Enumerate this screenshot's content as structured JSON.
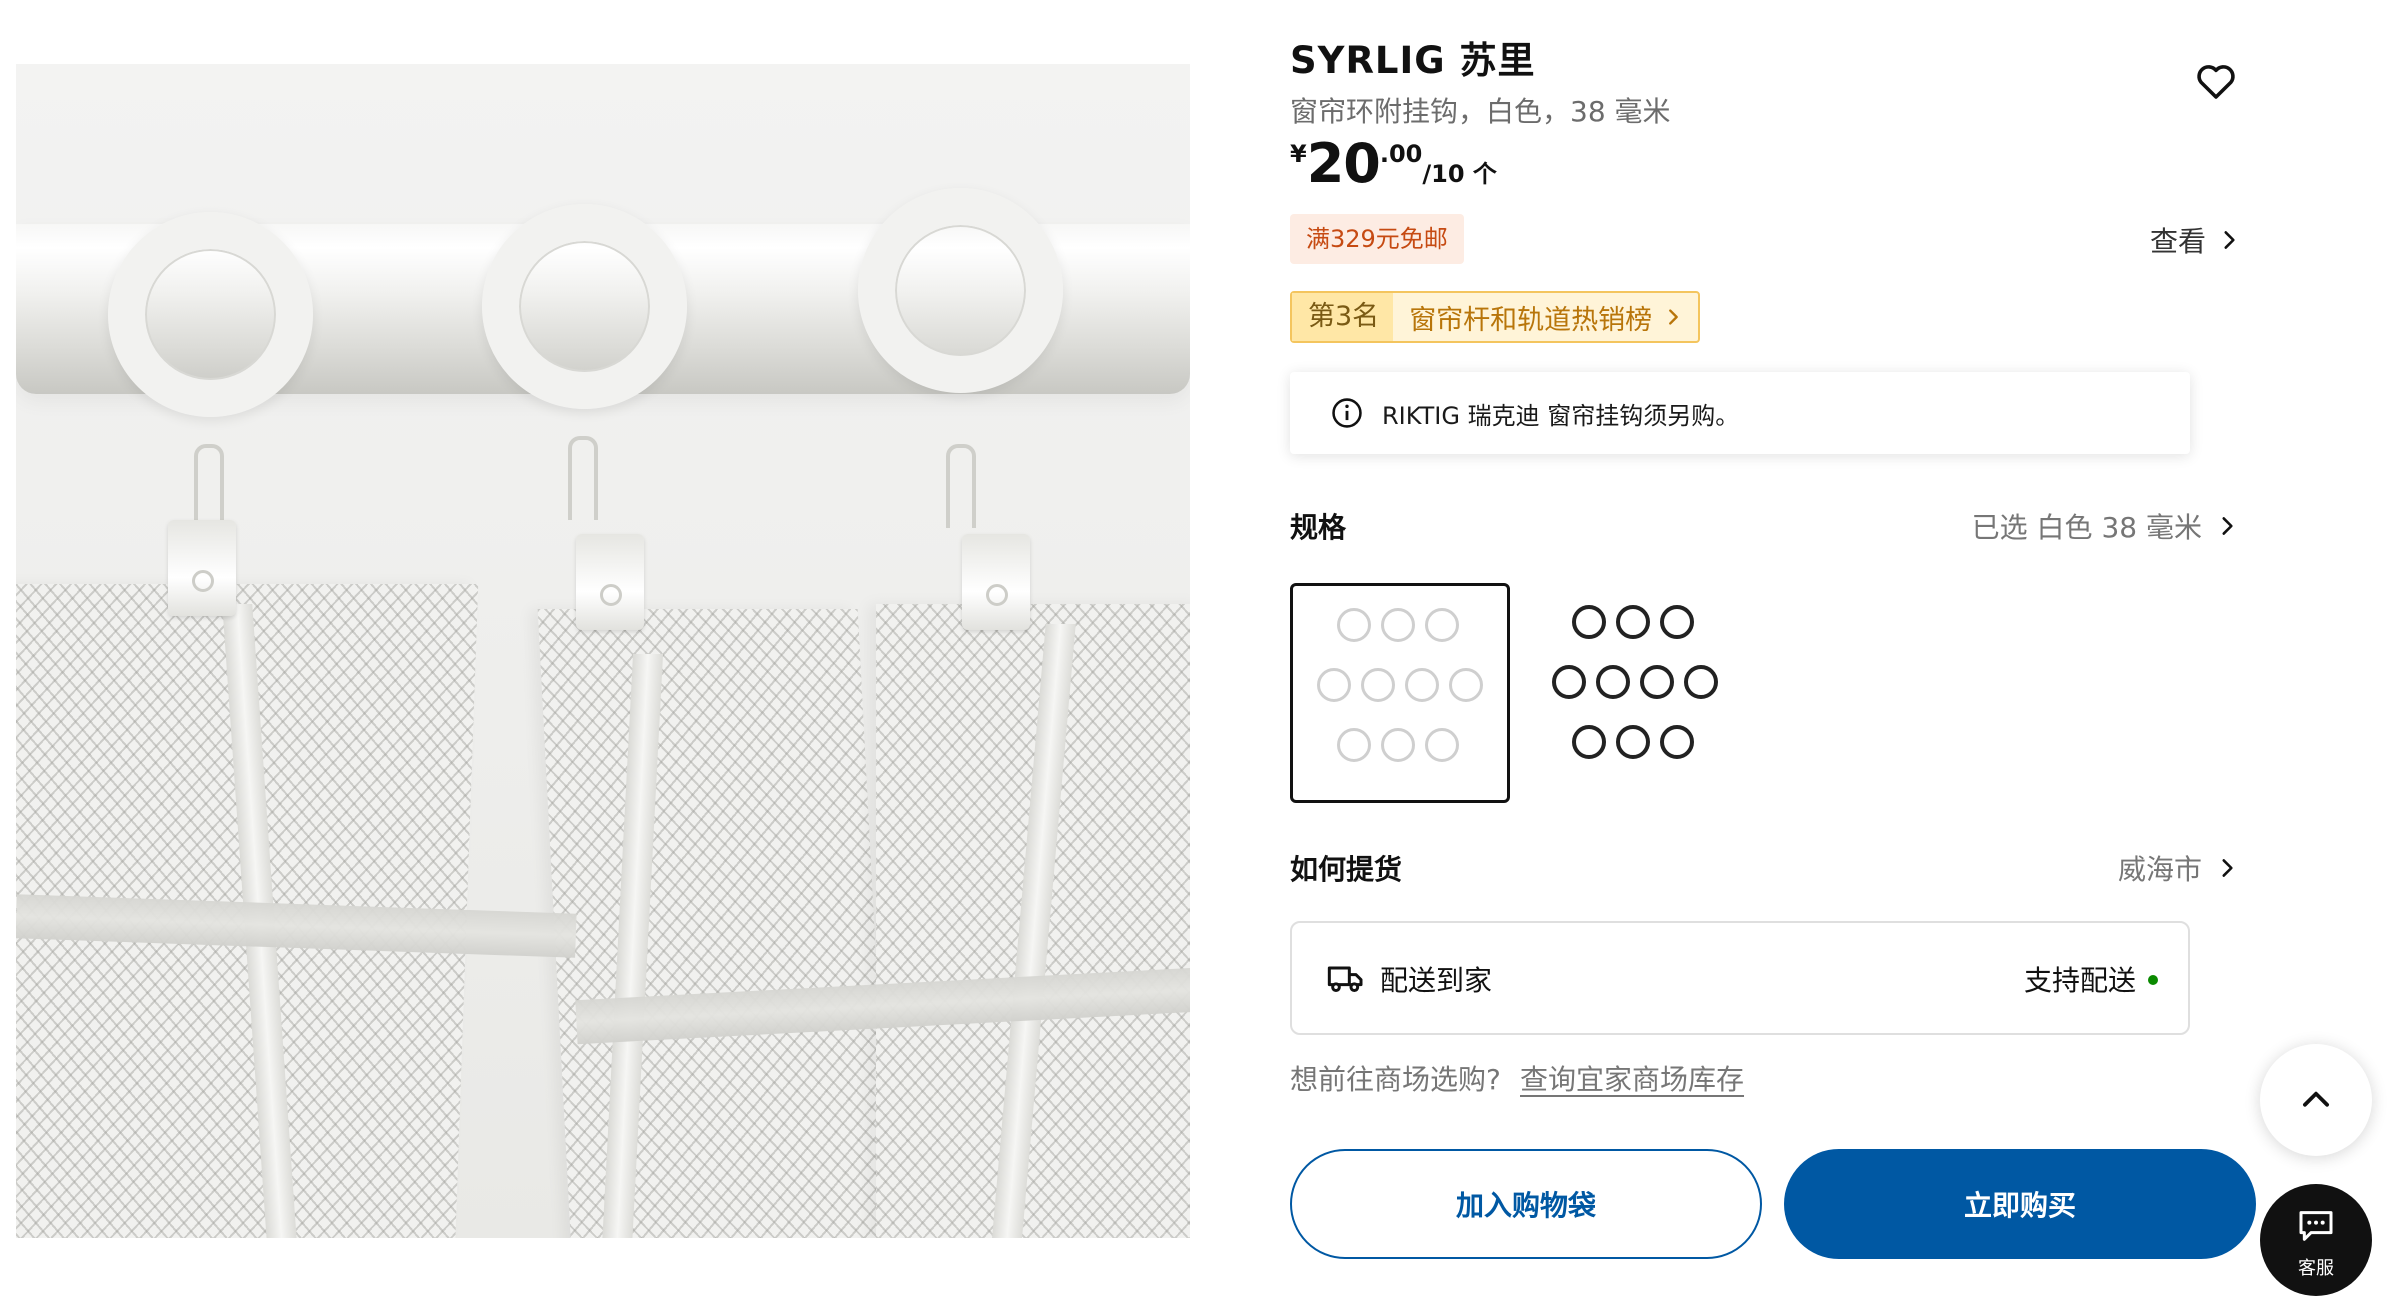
{
  "product": {
    "title": "SYRLIG 苏里",
    "subtitle": "窗帘环附挂钩，白色，38 毫米",
    "price": {
      "currency": "¥",
      "integer": "20",
      "decimal": ".00",
      "unit": "/10 个"
    },
    "promo_badge": "满329元免邮",
    "view_link": "查看",
    "ranking": {
      "position": "第3名",
      "label": "窗帘杆和轨道热销榜"
    },
    "notice": "RIKTIG 瑞克迪 窗帘挂钩须另购。"
  },
  "spec": {
    "heading": "规格",
    "selected_text": "已选 白色 38 毫米",
    "variants": [
      {
        "color": "white",
        "selected": true
      },
      {
        "color": "black",
        "selected": false
      }
    ]
  },
  "delivery": {
    "heading": "如何提货",
    "city": "威海市",
    "option_label": "配送到家",
    "option_status": "支持配送",
    "status_color": "#0a8a00"
  },
  "store": {
    "question": "想前往商场选购?",
    "link": "查询宜家商场库存"
  },
  "actions": {
    "add_to_bag": "加入购物袋",
    "buy_now": "立即购买"
  },
  "floating": {
    "chat_label": "客服"
  },
  "colors": {
    "brand_blue": "#0058a3",
    "promo_bg": "#fdece3",
    "promo_text": "#c64a12",
    "rank_border": "#f4c55e"
  },
  "icons": [
    "heart-icon",
    "chevron-right-icon",
    "info-icon",
    "truck-icon",
    "chevron-up-icon",
    "chat-icon"
  ]
}
